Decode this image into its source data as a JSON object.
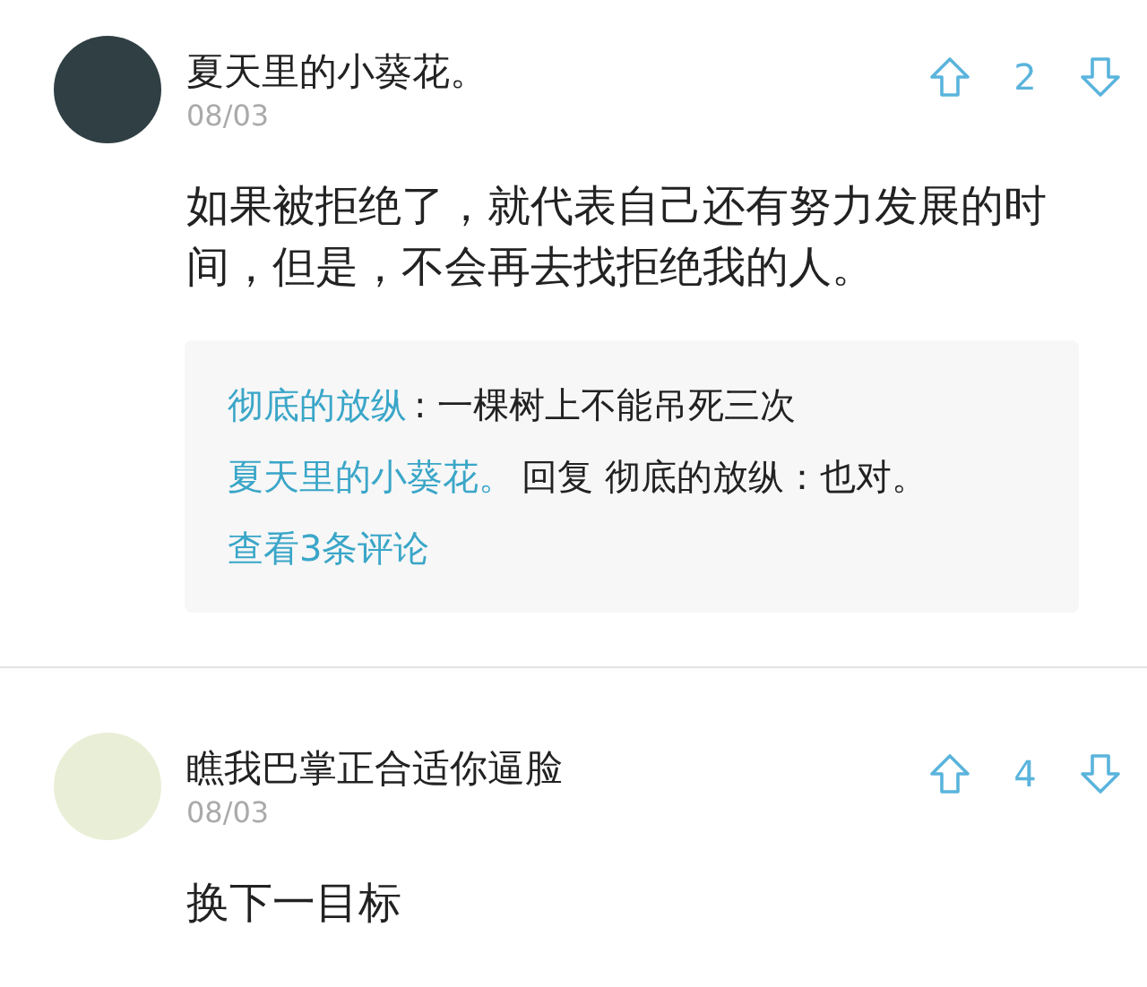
{
  "comments": [
    {
      "author": "夏天里的小葵花。",
      "date": "08/03",
      "votes": "2",
      "body": "如果被拒绝了，就代表自己还有努力发展的时间，但是，不会再去找拒绝我的人。",
      "replies": [
        {
          "author": "彻底的放纵",
          "text": ": 一棵树上不能吊死三次"
        },
        {
          "author": "夏天里的小葵花。",
          "text": "回复 彻底的放纵：也对。"
        }
      ],
      "more_link": "查看3条评论"
    },
    {
      "author": "瞧我巴掌正合适你逼脸",
      "date": "08/03",
      "votes": "4",
      "body": "换下一目标"
    }
  ]
}
